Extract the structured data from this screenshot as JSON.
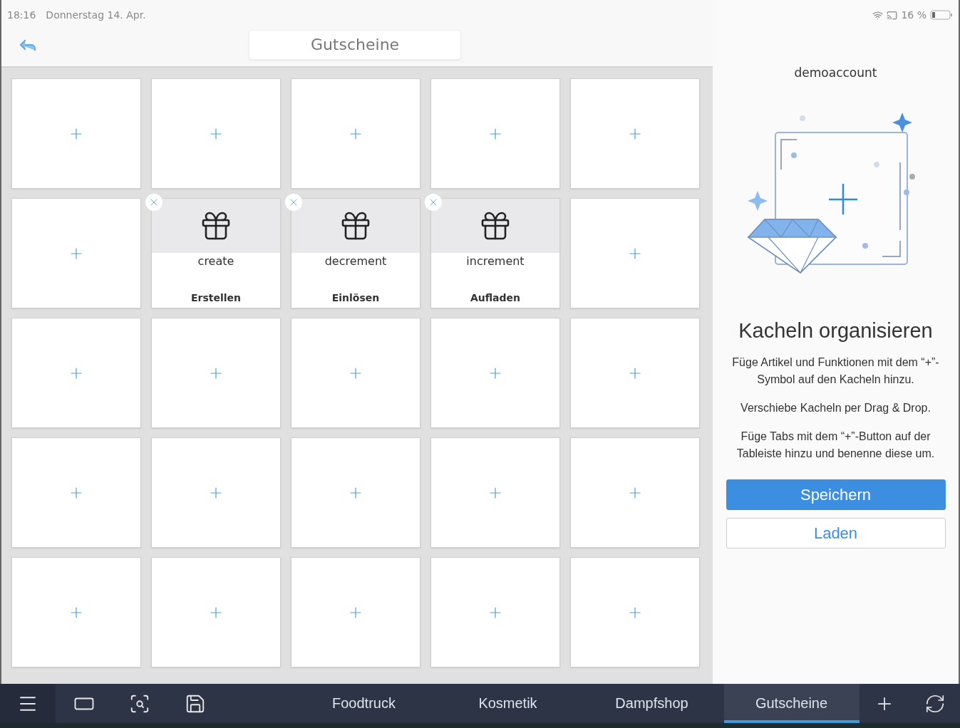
{
  "status_bar": {
    "time": "18:16",
    "date": "Donnerstag 14. Apr.",
    "battery": "16 %"
  },
  "header": {
    "title": "Gutscheine"
  },
  "tiles": [
    {
      "kind": "empty"
    },
    {
      "kind": "empty"
    },
    {
      "kind": "empty"
    },
    {
      "kind": "empty"
    },
    {
      "kind": "empty"
    },
    {
      "kind": "empty"
    },
    {
      "kind": "function",
      "name": "create",
      "label": "Erstellen"
    },
    {
      "kind": "function",
      "name": "decrement",
      "label": "Einlösen"
    },
    {
      "kind": "function",
      "name": "increment",
      "label": "Aufladen"
    },
    {
      "kind": "empty"
    },
    {
      "kind": "empty"
    },
    {
      "kind": "empty"
    },
    {
      "kind": "empty"
    },
    {
      "kind": "empty"
    },
    {
      "kind": "empty"
    },
    {
      "kind": "empty"
    },
    {
      "kind": "empty"
    },
    {
      "kind": "empty"
    },
    {
      "kind": "empty"
    },
    {
      "kind": "empty"
    },
    {
      "kind": "empty"
    },
    {
      "kind": "empty"
    },
    {
      "kind": "empty"
    },
    {
      "kind": "empty"
    },
    {
      "kind": "empty"
    }
  ],
  "panel": {
    "account": "demoaccount",
    "heading": "Kacheln organisieren",
    "paragraphs": [
      "Füge Artikel und Funktionen mit dem “+”-Symbol auf den Kacheln hinzu.",
      "Verschiebe Kacheln per Drag & Drop.",
      "Füge Tabs mit dem “+”-Button auf der Tableiste hinzu und benenne diese um."
    ],
    "buttons": [
      {
        "label": "Speichern",
        "kind": "primary"
      },
      {
        "label": "Laden",
        "kind": "secondary"
      }
    ]
  },
  "tabs": [
    {
      "label": "Foodtruck",
      "selected": false
    },
    {
      "label": "Kosmetik",
      "selected": false
    },
    {
      "label": "Dampfshop",
      "selected": false
    },
    {
      "label": "Gutscheine",
      "selected": true
    }
  ]
}
